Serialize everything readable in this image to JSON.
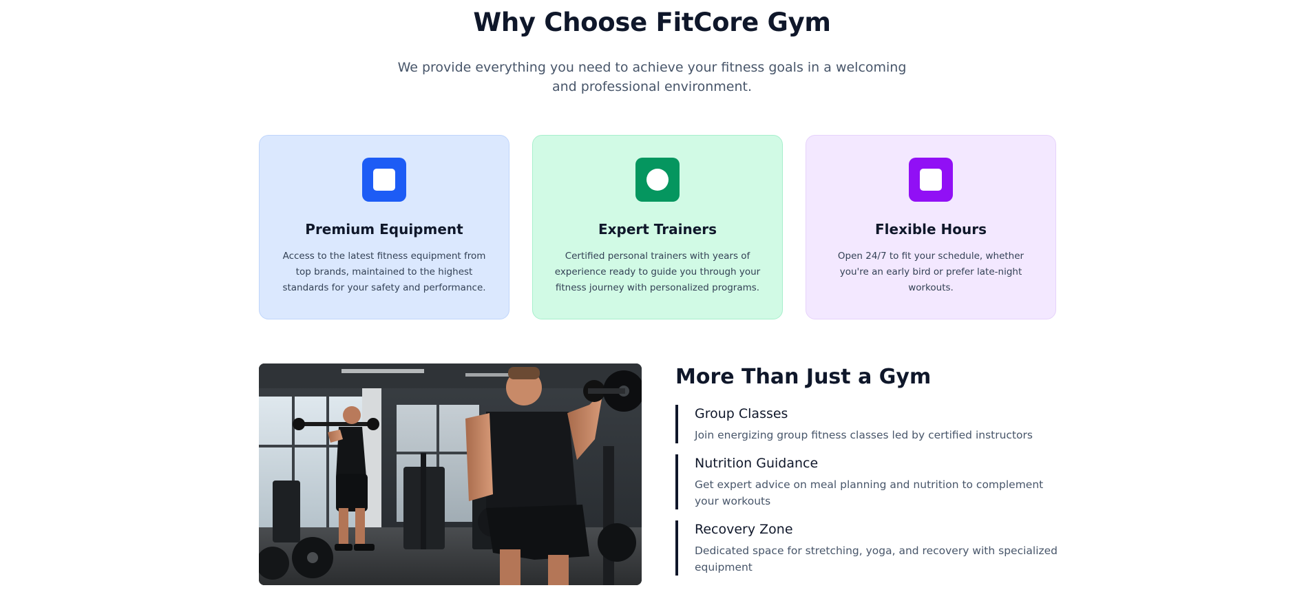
{
  "header": {
    "title": "Why Choose FitCore Gym",
    "subtitle": "We provide everything you need to achieve your fitness goals in a welcoming and professional environment."
  },
  "features": [
    {
      "title": "Premium Equipment",
      "description": "Access to the latest fitness equipment from top brands, maintained to the highest standards for your safety and performance.",
      "icon": "square-icon",
      "accent": "#1d5cf5",
      "background": "#dbe8fe"
    },
    {
      "title": "Expert Trainers",
      "description": "Certified personal trainers with years of experience ready to guide you through your fitness journey with personalized programs.",
      "icon": "circle-icon",
      "accent": "#05965f",
      "background": "#d1fae5"
    },
    {
      "title": "Flexible Hours",
      "description": "Open 24/7 to fit your schedule, whether you're an early bird or prefer late-night workouts.",
      "icon": "square-icon",
      "accent": "#9110f5",
      "background": "#f3e8ff"
    }
  ],
  "more_section": {
    "title": "More Than Just a Gym",
    "items": [
      {
        "title": "Group Classes",
        "description": "Join energizing group fitness classes led by certified instructors"
      },
      {
        "title": "Nutrition Guidance",
        "description": "Get expert advice on meal planning and nutrition to complement your workouts"
      },
      {
        "title": "Recovery Zone",
        "description": "Dedicated space for stretching, yoga, and recovery with specialized equipment"
      }
    ]
  }
}
